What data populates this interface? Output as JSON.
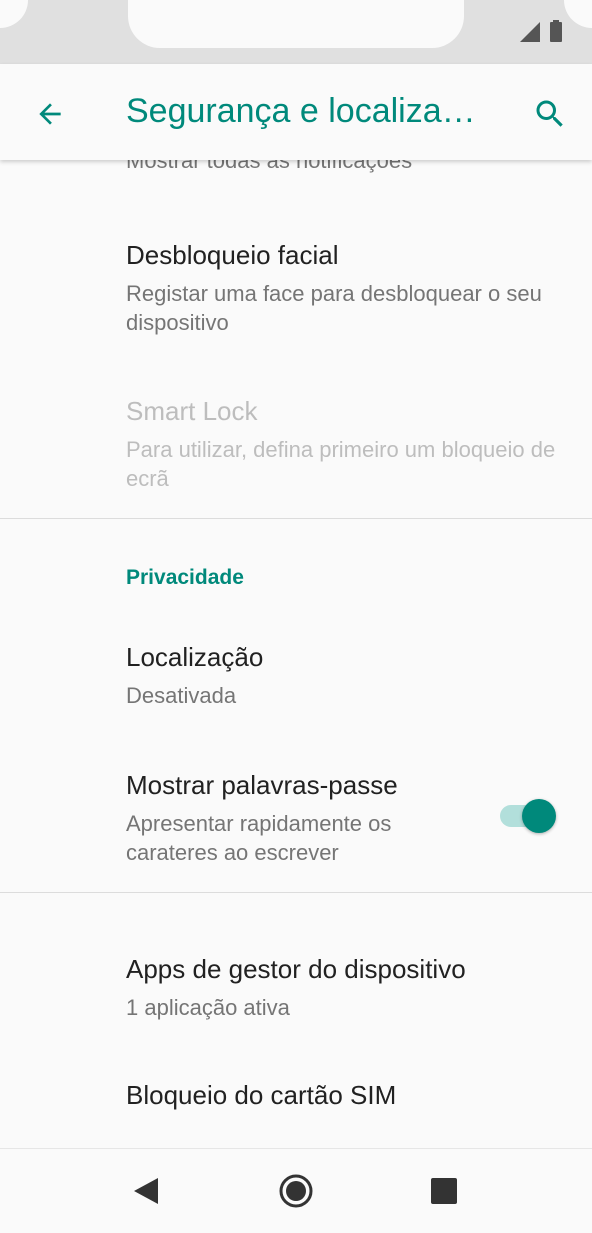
{
  "app_bar": {
    "title": "Segurança e localiza…",
    "back_icon": "arrow-back-icon",
    "search_icon": "search-icon"
  },
  "items": {
    "partial": {
      "title": "Mostrar todas as notificações"
    },
    "face_unlock": {
      "title": "Desbloqueio facial",
      "summary": "Registar uma face para desbloquear o seu dispositivo"
    },
    "smart_lock": {
      "title": "Smart Lock",
      "summary": "Para utilizar, defina primeiro um bloqueio de ecrã"
    },
    "location": {
      "title": "Localização",
      "summary": "Desativada"
    },
    "show_passwords": {
      "title": "Mostrar palavras-passe",
      "summary": "Apresentar rapidamente os carateres ao escrever",
      "enabled": true
    },
    "device_admin": {
      "title": "Apps de gestor do dispositivo",
      "summary": "1 aplicação ativa"
    },
    "sim_lock": {
      "title": "Bloqueio do cartão SIM"
    }
  },
  "sections": {
    "privacy": "Privacidade"
  },
  "colors": {
    "accent": "#00897b",
    "toggle_track": "#b2dfdb"
  },
  "nav": {
    "back": "nav-back-icon",
    "home": "nav-home-icon",
    "recents": "nav-recents-icon"
  }
}
